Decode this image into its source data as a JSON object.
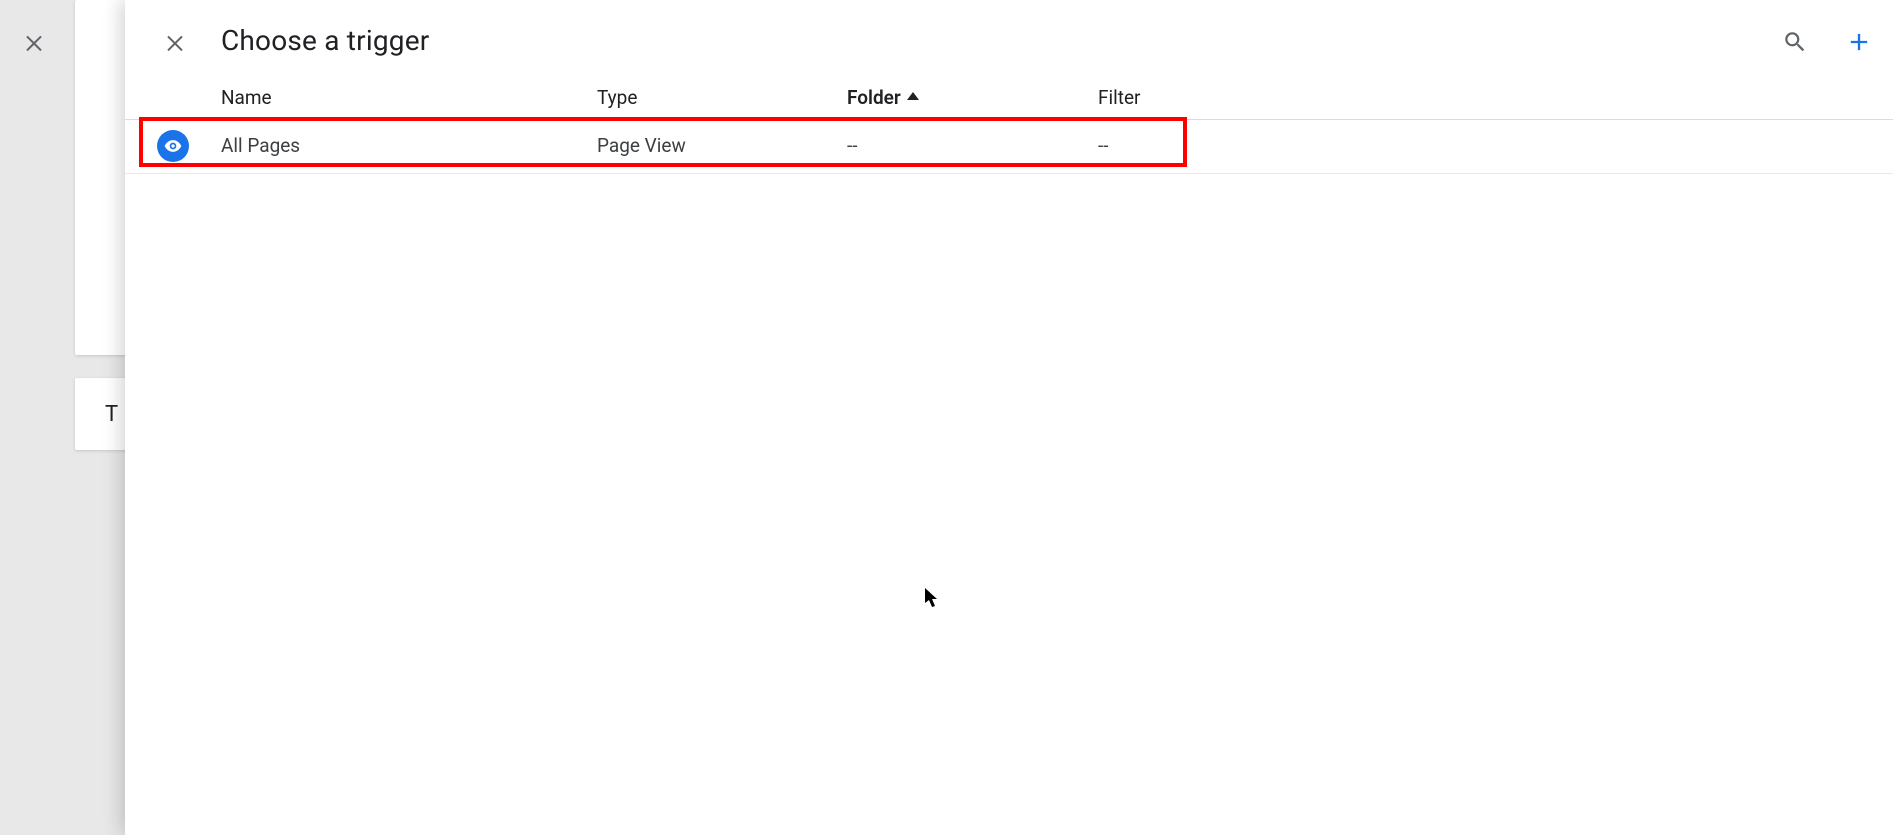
{
  "panel": {
    "title": "Choose a trigger",
    "columns": {
      "name": "Name",
      "type": "Type",
      "folder": "Folder",
      "filter": "Filter"
    },
    "sorted_by": "Folder",
    "sort_dir": "asc",
    "rows": [
      {
        "icon": "page-view-icon",
        "name": "All Pages",
        "type": "Page View",
        "folder": "--",
        "filter": "--"
      }
    ],
    "highlighted_row": 0
  },
  "background": {
    "secondary_panel_text": "T"
  },
  "icons": {
    "close": "close-icon",
    "search": "search-icon",
    "add": "plus-icon",
    "sort_asc": "triangle-up-icon"
  },
  "colors": {
    "accent": "#1a73e8",
    "border": "#dadce0",
    "text": "#202124",
    "muted": "#5f6368",
    "highlight": "#ff0000"
  }
}
